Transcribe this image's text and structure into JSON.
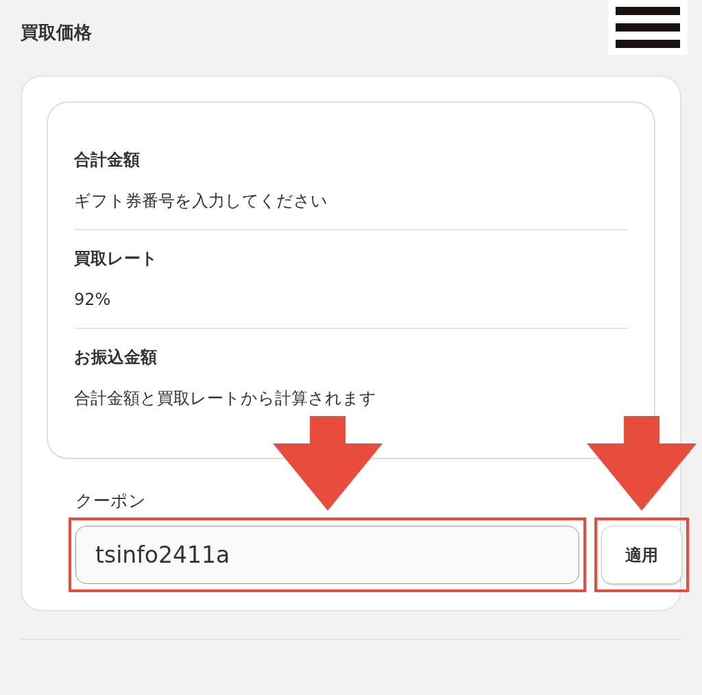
{
  "page_title": "買取価格",
  "menu": {
    "kind": "hamburger"
  },
  "summary": [
    {
      "label": "合計金額",
      "value": "ギフト券番号を入力してください"
    },
    {
      "label": "買取レート",
      "value": "92%"
    },
    {
      "label": "お振込金額",
      "value": "合計金額と買取レートから計算されます"
    }
  ],
  "coupon": {
    "label": "クーポン",
    "value": "tsinfo2411a",
    "highlighted": true
  },
  "apply_button": {
    "label": "適用",
    "highlighted": true
  }
}
